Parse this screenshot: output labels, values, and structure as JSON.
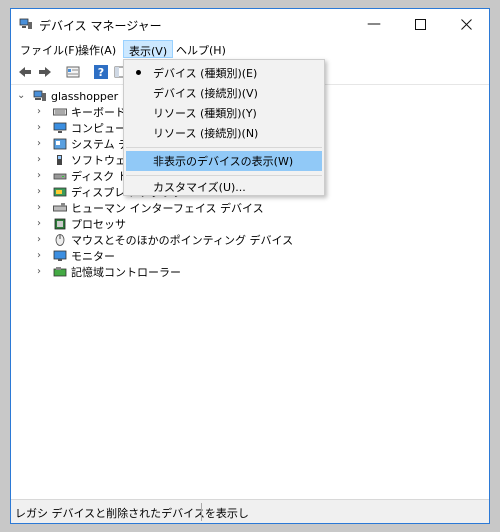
{
  "window": {
    "title": "デバイス マネージャー"
  },
  "menu": [
    "ファイル(F)",
    "操作(A)",
    "表示(V)",
    "ヘルプ(H)"
  ],
  "tree": {
    "root": "glasshopper",
    "items": [
      {
        "label": "キーボード",
        "icon": "keyboard-icon"
      },
      {
        "label": "コンピューター",
        "icon": "computer-icon"
      },
      {
        "label": "システム デバイス",
        "icon": "system-device-icon"
      },
      {
        "label": "ソフトウェア デバイス",
        "icon": "software-device-icon"
      },
      {
        "label": "ディスク ドライブ",
        "icon": "disk-drive-icon"
      },
      {
        "label": "ディスプレイ アダプター",
        "icon": "display-adapter-icon"
      },
      {
        "label": "ヒューマン インターフェイス デバイス",
        "icon": "hid-icon"
      },
      {
        "label": "プロセッサ",
        "icon": "processor-icon"
      },
      {
        "label": "マウスとそのほかのポインティング デバイス",
        "icon": "mouse-icon"
      },
      {
        "label": "モニター",
        "icon": "monitor-icon"
      },
      {
        "label": "記憶域コントローラー",
        "icon": "storage-controller-icon"
      }
    ]
  },
  "view_menu": {
    "items": [
      {
        "label": "デバイス (種類別)(E)",
        "checked": true
      },
      {
        "label": "デバイス (接続別)(V)",
        "checked": false
      },
      {
        "label": "リソース (種類別)(Y)",
        "checked": false
      },
      {
        "label": "リソース (接続別)(N)",
        "checked": false
      }
    ],
    "show_hidden": "非表示のデバイスの表示(W)",
    "customize": "カスタマイズ(U)..."
  },
  "status": "レガシ デバイスと削除されたデバイスを表示し"
}
